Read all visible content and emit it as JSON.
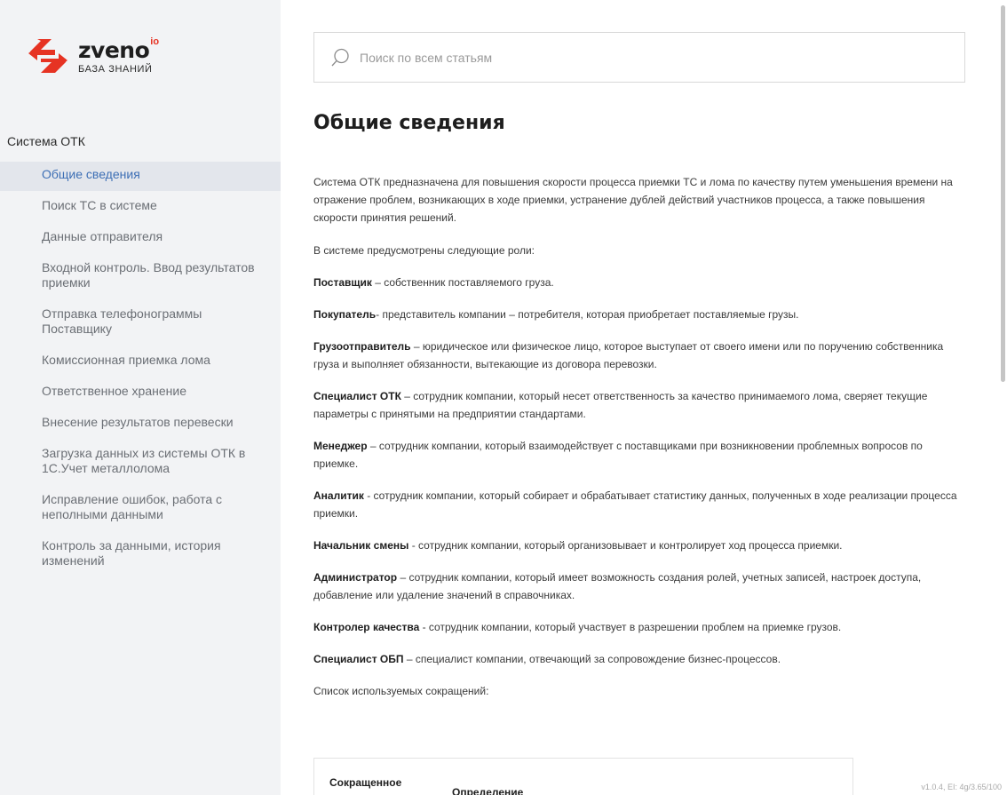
{
  "brand": {
    "name": "zveno",
    "sup": "io",
    "subtitle": "БАЗА ЗНАНИЙ",
    "accent": "#e63323"
  },
  "sidebar": {
    "section_title": "Система ОТК",
    "items": [
      {
        "label": "Общие сведения",
        "active": true
      },
      {
        "label": "Поиск ТС в системе",
        "active": false
      },
      {
        "label": "Данные отправителя",
        "active": false
      },
      {
        "label": "Входной контроль. Ввод результатов приемки",
        "active": false
      },
      {
        "label": "Отправка телефонограммы Поставщику",
        "active": false
      },
      {
        "label": "Комиссионная приемка лома",
        "active": false
      },
      {
        "label": "Ответственное хранение",
        "active": false
      },
      {
        "label": "Внесение результатов перевески",
        "active": false
      },
      {
        "label": "Загрузка данных из системы ОТК в 1С.Учет металлолома",
        "active": false
      },
      {
        "label": "Исправление ошибок, работа с неполными данными",
        "active": false
      },
      {
        "label": "Контроль за данными, история изменений",
        "active": false
      }
    ]
  },
  "search": {
    "icon": "search-icon",
    "placeholder": "Поиск по всем статьям",
    "value": ""
  },
  "article": {
    "title": "Общие сведения",
    "intro": "Система ОТК предназначена для повышения скорости процесса приемки ТС и лома по качеству путем уменьшения времени на отражение проблем, возникающих в ходе приемки, устранение дублей действий участников процесса, а также повышения скорости принятия решений.",
    "roles_intro": "В системе предусмотрены следующие роли:",
    "roles": [
      {
        "term": "Поставщик",
        "desc": " – собственник поставляемого груза."
      },
      {
        "term": "Покупатель",
        "desc": "- представитель компании – потребителя, которая приобретает поставляемые грузы."
      },
      {
        "term": "Грузоотправитель",
        "desc": " – юридическое или физическое лицо, которое выступает от своего имени или по поручению собственника груза и выполняет обязанности, вытекающие из договора перевозки."
      },
      {
        "term": "Специалист ОТК",
        "desc": " – сотрудник компании, который несет ответственность за качество принимаемого лома, сверяет текущие параметры с принятыми на предприятии стандартами."
      },
      {
        "term": "Менеджер",
        "desc": " – сотрудник компании, который взаимодействует с поставщиками при возникновении проблемных вопросов по приемке."
      },
      {
        "term": "Аналитик",
        "desc": " - сотрудник компании, который собирает и обрабатывает статистику данных, полученных в ходе реализации процесса приемки."
      },
      {
        "term": "Начальник смены",
        "desc": " - сотрудник компании, который организовывает и контролирует ход процесса приемки."
      },
      {
        "term": "Администратор",
        "desc": " – сотрудник компании, который имеет возможность создания ролей, учетных записей, настроек доступа, добавление или удаление значений в справочниках."
      },
      {
        "term": "Контролер качества",
        "desc": " - сотрудник компании, который участвует в разрешении проблем на приемке грузов."
      },
      {
        "term": "Специалист ОБП",
        "desc": " – специалист компании, отвечающий за сопровождение бизнес-процессов."
      }
    ],
    "abbrev_intro": "Список используемых сокращений:",
    "table": {
      "col1": "Сокращенное",
      "col2": "Определение"
    }
  },
  "version": "v1.0.4, EI: 4g/3.65/100"
}
